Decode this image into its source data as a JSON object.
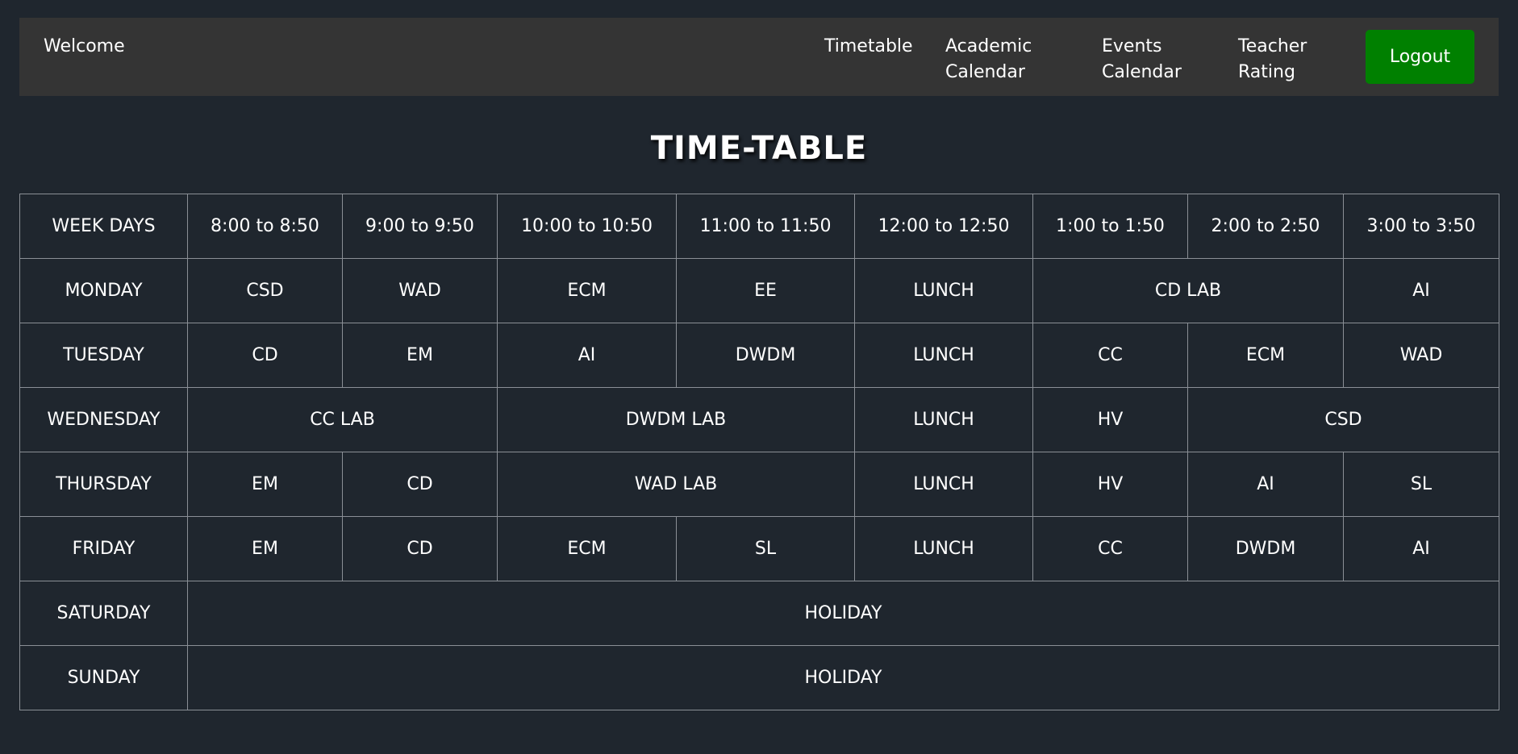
{
  "nav": {
    "brand": "Welcome",
    "links": [
      {
        "line1": "Timetable",
        "line2": ""
      },
      {
        "line1": "Academic",
        "line2": "Calendar"
      },
      {
        "line1": "Events",
        "line2": "Calendar"
      },
      {
        "line1": "Teacher",
        "line2": "Rating"
      }
    ],
    "logout_label": "Logout"
  },
  "page": {
    "title": "TIME-TABLE"
  },
  "timetable": {
    "headers": [
      "WEEK DAYS",
      "8:00 to 8:50",
      "9:00 to 9:50",
      "10:00 to 10:50",
      "11:00 to 11:50",
      "12:00 to 12:50",
      "1:00 to 1:50",
      "2:00 to 2:50",
      "3:00 to 3:50"
    ],
    "rows": [
      {
        "day": "MONDAY",
        "cells": [
          "CSD",
          "WAD",
          "ECM",
          "EE",
          "LUNCH",
          "CD LAB",
          "AI"
        ]
      },
      {
        "day": "TUESDAY",
        "cells": [
          "CD",
          "EM",
          "AI",
          "DWDM",
          "LUNCH",
          "CC",
          "ECM",
          "WAD"
        ]
      },
      {
        "day": "WEDNESDAY",
        "cells": [
          "CC LAB",
          "DWDM LAB",
          "LUNCH",
          "HV",
          "CSD"
        ]
      },
      {
        "day": "THURSDAY",
        "cells": [
          "EM",
          "CD",
          "WAD LAB",
          "LUNCH",
          "HV",
          "AI",
          "SL"
        ]
      },
      {
        "day": "FRIDAY",
        "cells": [
          "EM",
          "CD",
          "ECM",
          "SL",
          "LUNCH",
          "CC",
          "DWDM",
          "AI"
        ]
      },
      {
        "day": "SATURDAY",
        "cells": [
          "HOLIDAY"
        ]
      },
      {
        "day": "SUNDAY",
        "cells": [
          "HOLIDAY"
        ]
      }
    ]
  },
  "colors": {
    "background": "#1f262e",
    "navbar": "#343434",
    "logout_button": "#008000",
    "table_border": "#8a8f96",
    "text": "#ffffff"
  }
}
